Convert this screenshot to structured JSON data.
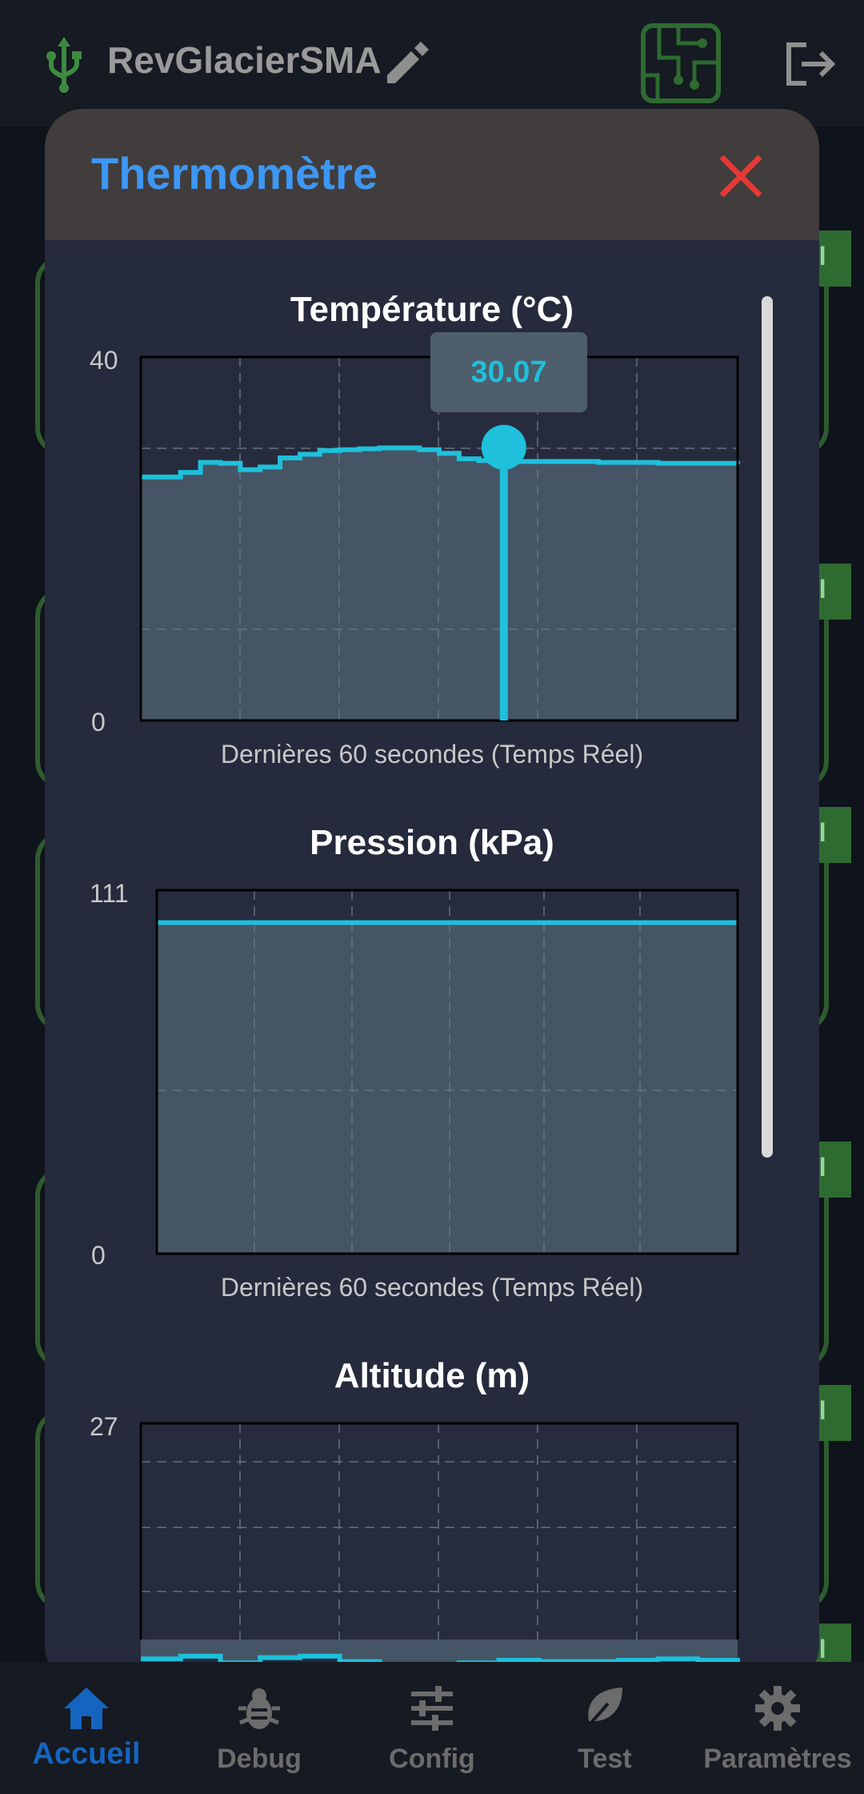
{
  "app": {
    "device_name": "RevGlacierSMA",
    "colors": {
      "accent": "#3d97f4",
      "series": "#1ec0db",
      "danger": "#e53935",
      "green": "#2e6b30"
    }
  },
  "background_tab_label": "el",
  "dialog": {
    "title": "Thermomètre",
    "close_icon": "close-icon"
  },
  "charts_caption": "Dernières 60 secondes (Temps Réel)",
  "tooltip_value": "30.07",
  "chart_data": [
    {
      "type": "area",
      "title": "Température (°C)",
      "xlabel": "Dernières 60 secondes (Temps Réel)",
      "ylim": [
        0,
        40
      ],
      "ytick_labels": [
        "40",
        "0"
      ],
      "x": [
        0,
        2,
        4,
        6,
        8,
        10,
        12,
        14,
        16,
        18,
        20,
        22,
        24,
        26,
        28,
        30,
        32,
        34,
        36,
        38,
        40,
        42,
        44,
        46,
        48,
        50,
        52,
        54,
        56,
        58,
        60
      ],
      "values": [
        26.8,
        26.8,
        27.3,
        28.4,
        28.3,
        27.6,
        27.9,
        28.9,
        29.3,
        29.7,
        29.8,
        29.9,
        30.0,
        30.0,
        29.8,
        29.4,
        28.8,
        28.6,
        28.6,
        28.5,
        28.5,
        28.5,
        28.5,
        28.4,
        28.4,
        28.4,
        28.3,
        28.3,
        28.3,
        28.3,
        28.2
      ],
      "highlight": {
        "x": 36.5,
        "y": 30.07
      },
      "grid": true
    },
    {
      "type": "area",
      "title": "Pression (kPa)",
      "xlabel": "Dernières 60 secondes (Temps Réel)",
      "ylim": [
        0,
        111
      ],
      "ytick_labels": [
        "111",
        "0"
      ],
      "x": [
        0,
        60
      ],
      "values": [
        101.1,
        101.1
      ],
      "grid": true
    },
    {
      "type": "area",
      "title": "Altitude (m)",
      "ylim": [
        0,
        27
      ],
      "ytick_labels": [
        "27"
      ],
      "x": [
        0,
        4,
        8,
        12,
        16,
        20,
        24,
        28,
        32,
        36,
        40,
        44,
        48,
        52,
        56,
        60
      ],
      "values": [
        9.5,
        9.7,
        9.2,
        9.6,
        9.7,
        9.3,
        9.1,
        8.9,
        9.2,
        9.4,
        9.3,
        9.3,
        9.4,
        9.5,
        9.4,
        9.0
      ],
      "grid": true
    }
  ],
  "nav": [
    {
      "label": "Accueil",
      "icon": "home-icon",
      "active": true
    },
    {
      "label": "Debug",
      "icon": "bug-icon",
      "active": false
    },
    {
      "label": "Config",
      "icon": "sliders-icon",
      "active": false
    },
    {
      "label": "Test",
      "icon": "leaf-icon",
      "active": false
    },
    {
      "label": "Paramètres",
      "icon": "gear-icon",
      "active": false
    }
  ]
}
